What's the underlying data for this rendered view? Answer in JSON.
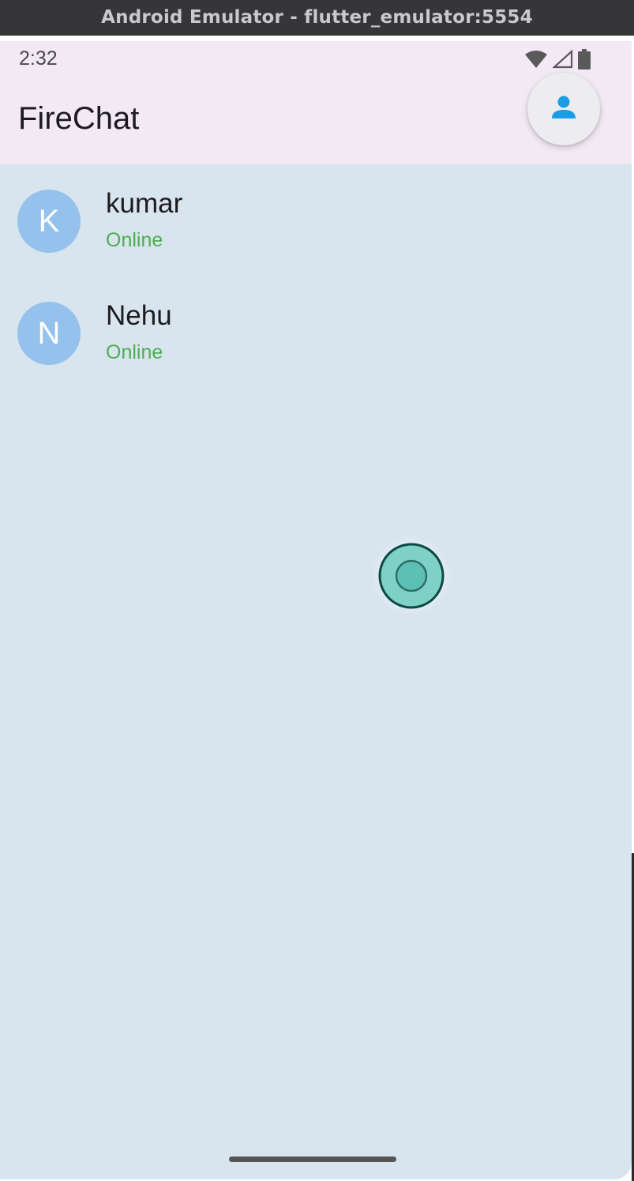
{
  "window": {
    "title": "Android Emulator - flutter_emulator:5554"
  },
  "status_bar": {
    "time": "2:32",
    "icons": [
      "wifi-icon",
      "signal-icon",
      "battery-icon"
    ]
  },
  "app_bar": {
    "title": "FireChat",
    "action_icon": "person-icon"
  },
  "users": [
    {
      "initial": "K",
      "name": "kumar",
      "status": "Online"
    },
    {
      "initial": "N",
      "name": "Nehu",
      "status": "Online"
    }
  ],
  "colors": {
    "app_bar_bg": "#f2e9f4",
    "body_bg": "#d8e4ee",
    "avatar_bg": "#94c2ed",
    "online_status": "#4caf50",
    "profile_icon": "#1a9ee3",
    "touch_indicator": "#5cc0b5"
  }
}
